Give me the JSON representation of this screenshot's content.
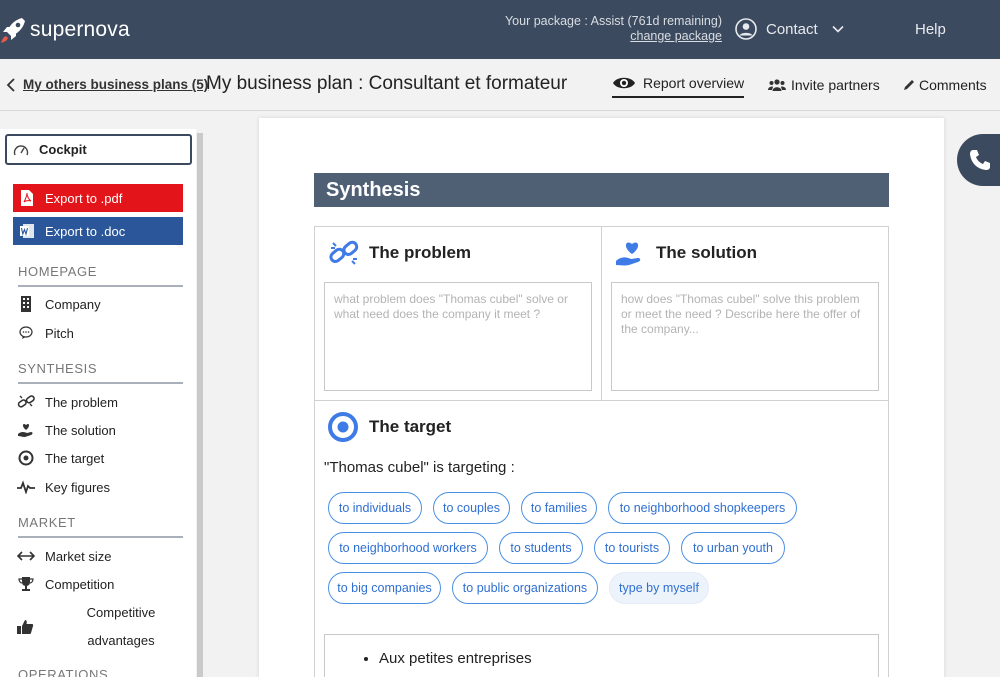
{
  "app": {
    "name": "supernova"
  },
  "header": {
    "package_text": "Your package : Assist (761d remaining)",
    "change_package": "change package",
    "contact": "Contact",
    "help": "Help"
  },
  "subbar": {
    "back_link": "My others business plans (5)",
    "plan_title": "My business plan : Consultant et formateur",
    "tabs": [
      "Report overview",
      "Invite partners",
      "Comments"
    ]
  },
  "sidebar": {
    "cockpit": "Cockpit",
    "export_pdf": "Export to .pdf",
    "export_doc": "Export to .doc",
    "sections": [
      {
        "title": "HOMEPAGE",
        "items": [
          "Company",
          "Pitch"
        ]
      },
      {
        "title": "SYNTHESIS",
        "items": [
          "The problem",
          "The solution",
          "The target",
          "Key figures"
        ]
      },
      {
        "title": "MARKET",
        "items": [
          "Market size",
          "Competition",
          "Competitive advantages"
        ]
      },
      {
        "title": "OPERATIONS",
        "items": []
      }
    ],
    "competitive_line1": "Competitive",
    "competitive_line2": "advantages"
  },
  "main": {
    "section_title": "Synthesis",
    "problem": {
      "title": "The problem",
      "placeholder": "what problem does \"Thomas cubel\" solve or what need does the company it meet ?"
    },
    "solution": {
      "title": "The solution",
      "placeholder": "how does \"Thomas cubel\" solve this problem or meet the need ? Describe here the offer of the company..."
    },
    "target": {
      "title": "The target",
      "targeting_text": "\"Thomas cubel\" is targeting :",
      "chips": [
        "to individuals",
        "to couples",
        "to families",
        "to neighborhood shopkeepers",
        "to neighborhood workers",
        "to students",
        "to tourists",
        "to urban youth",
        "to big companies",
        "to public organizations",
        "type by myself"
      ],
      "list": [
        "Aux petites entreprises"
      ]
    }
  },
  "colors": {
    "topbar": "#3b4a5e",
    "synthesis_bar": "#4f6074",
    "accent_blue": "#4a90e2",
    "pdf_red": "#e3151a",
    "doc_blue": "#2b579a"
  }
}
